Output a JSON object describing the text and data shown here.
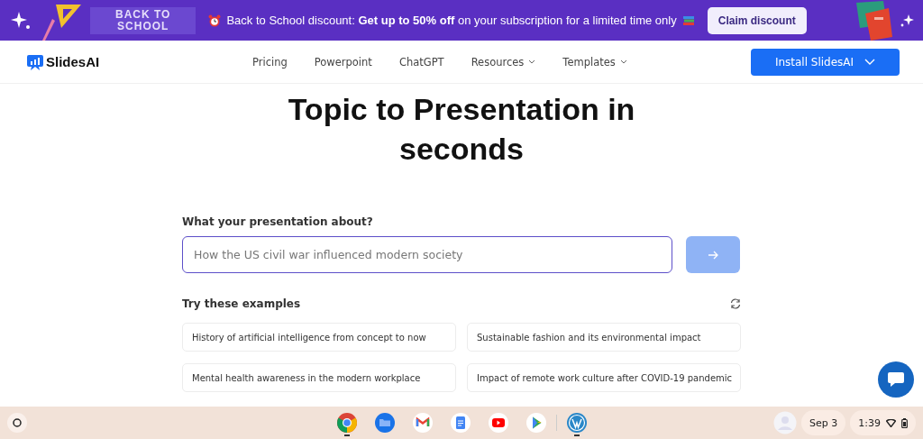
{
  "banner": {
    "badge_lines": [
      "BACK TO",
      "SCHOOL"
    ],
    "message": "Back to School discount: **Get up to 50% off** on your subscription for a limited time only",
    "button": "Claim discount"
  },
  "nav": {
    "logo": "SlidesAI",
    "items": [
      {
        "label": "Pricing",
        "dropdown": false
      },
      {
        "label": "Powerpoint",
        "dropdown": false
      },
      {
        "label": "ChatGPT",
        "dropdown": false
      },
      {
        "label": "Resources",
        "dropdown": true
      },
      {
        "label": "Templates",
        "dropdown": true
      }
    ],
    "install_button": "Install SlidesAI"
  },
  "hero": {
    "title": "Topic to Presentation in seconds",
    "prompt_label": "What your presentation about?",
    "placeholder": "How the US civil war influenced modern society"
  },
  "examples": {
    "heading": "Try these examples",
    "items": [
      "History of artificial intelligence from concept to now",
      "Sustainable fashion and its environmental impact",
      "Mental health awareness in the modern workplace",
      "Impact of remote work culture after COVID-19 pandemic"
    ]
  },
  "taskbar": {
    "apps": [
      {
        "kind": "chrome",
        "open": true
      },
      {
        "kind": "files",
        "open": false
      },
      {
        "kind": "gmail",
        "open": false
      },
      {
        "kind": "docs",
        "open": false
      },
      {
        "kind": "youtube",
        "open": false
      },
      {
        "kind": "play",
        "open": false
      },
      {
        "kind": "wordpress",
        "open": true
      }
    ],
    "date": "Sep 3",
    "time": "1:39"
  }
}
